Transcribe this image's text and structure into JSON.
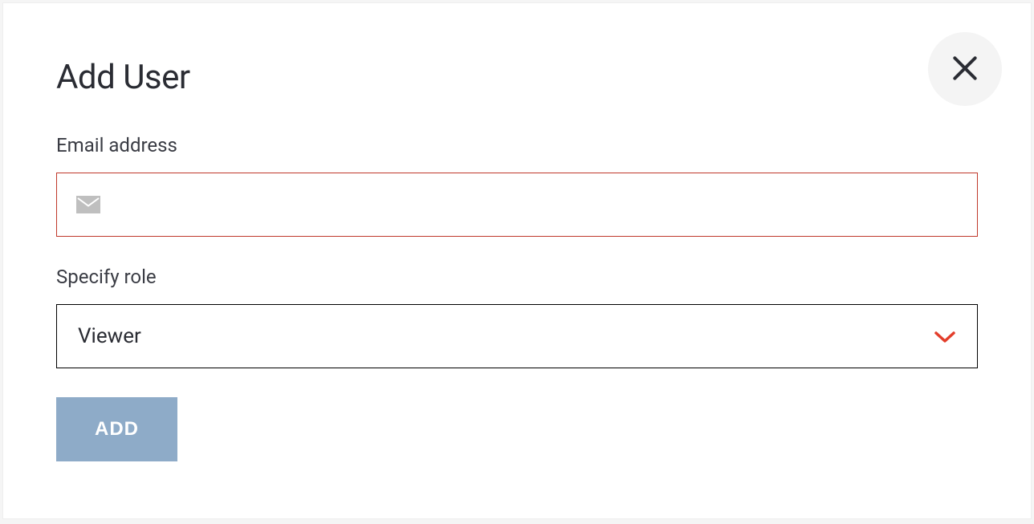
{
  "modal": {
    "title": "Add User",
    "close_icon": "close-icon"
  },
  "form": {
    "email": {
      "label": "Email address",
      "value": "",
      "placeholder": ""
    },
    "role": {
      "label": "Specify role",
      "selected": "Viewer"
    },
    "submit_label": "ADD"
  },
  "colors": {
    "error_border": "#c0392b",
    "accent_chevron": "#e33e2b",
    "button_bg": "#8eabc8"
  }
}
